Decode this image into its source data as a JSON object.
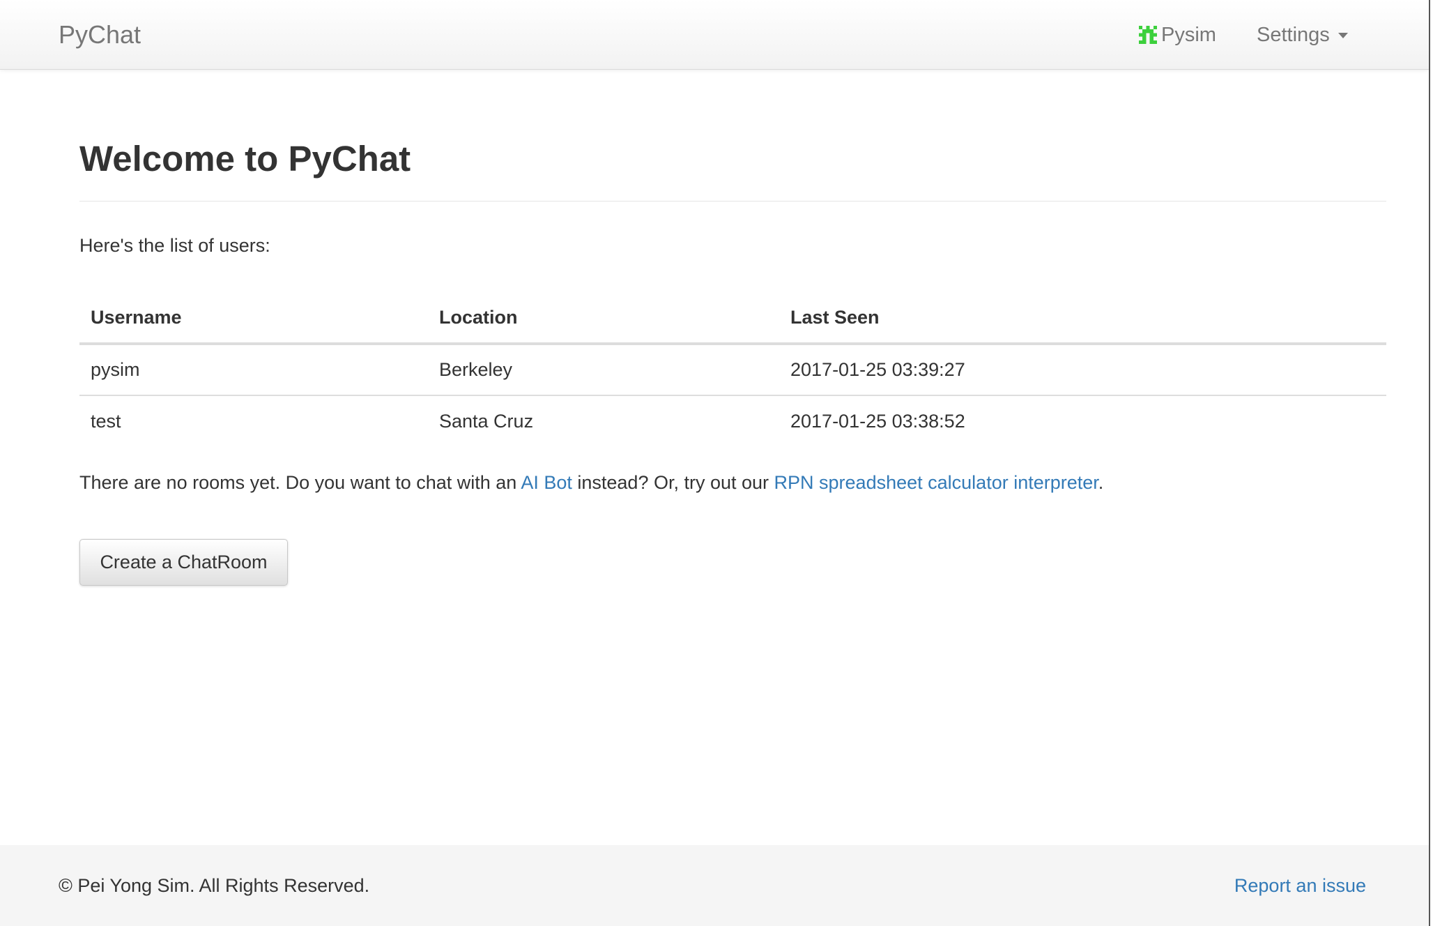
{
  "navbar": {
    "brand": "PyChat",
    "user_name": "Pysim",
    "settings_label": "Settings"
  },
  "main": {
    "title": "Welcome to PyChat",
    "intro": "Here's the list of users:",
    "table": {
      "headers": [
        "Username",
        "Location",
        "Last Seen"
      ],
      "rows": [
        [
          "pysim",
          "Berkeley",
          "2017-01-25 03:39:27"
        ],
        [
          "test",
          "Santa Cruz",
          "2017-01-25 03:38:52"
        ]
      ]
    },
    "rooms_message": {
      "part1": "There are no rooms yet. Do you want to chat with an ",
      "ai_bot_link": "AI Bot",
      "part2": " instead? Or, try out our ",
      "rpn_link": "RPN spreadsheet calculator interpreter",
      "part3": "."
    },
    "create_button": "Create a ChatRoom"
  },
  "footer": {
    "copyright": "© Pei Yong Sim. All Rights Reserved.",
    "report_link": "Report an issue"
  },
  "colors": {
    "link": "#337ab7",
    "navbar_text": "#777777",
    "avatar": "#3cd03c"
  },
  "icons": {
    "avatar": "identicon-avatar-icon",
    "dropdown": "caret-down-icon"
  }
}
